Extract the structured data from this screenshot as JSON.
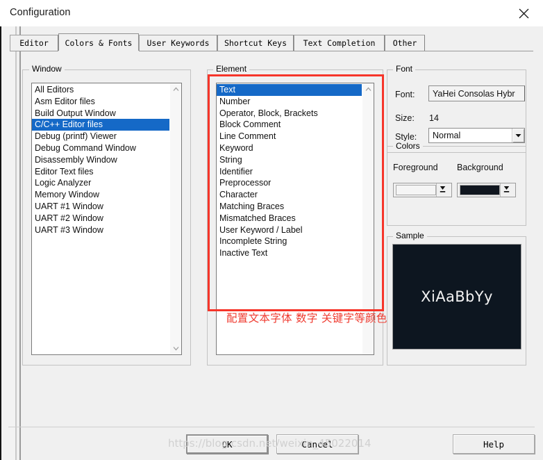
{
  "window": {
    "title": "Configuration",
    "close_icon": "close-icon"
  },
  "tabs": [
    {
      "label": "Editor",
      "selected": false
    },
    {
      "label": "Colors & Fonts",
      "selected": true
    },
    {
      "label": "User Keywords",
      "selected": false
    },
    {
      "label": "Shortcut Keys",
      "selected": false
    },
    {
      "label": "Text Completion",
      "selected": false
    },
    {
      "label": "Other",
      "selected": false
    }
  ],
  "window_group": {
    "legend": "Window",
    "items": [
      "All Editors",
      "Asm Editor files",
      "Build Output Window",
      "C/C++ Editor files",
      "Debug (printf) Viewer",
      "Debug Command Window",
      "Disassembly Window",
      "Editor Text files",
      "Logic Analyzer",
      "Memory Window",
      "UART #1 Window",
      "UART #2 Window",
      "UART #3 Window"
    ],
    "selected_index": 3,
    "scroll_up_icon": "chevron-up-icon",
    "scroll_down_icon": "chevron-down-icon"
  },
  "element_group": {
    "legend": "Element",
    "items": [
      "Text",
      "Number",
      "Operator, Block, Brackets",
      "Block Comment",
      "Line Comment",
      "Keyword",
      "String",
      "Identifier",
      "Preprocessor",
      "Character",
      "Matching Braces",
      "Mismatched Braces",
      "User Keyword / Label",
      "Incomplete String",
      "Inactive Text"
    ],
    "selected_index": 0,
    "scroll_up_icon": "chevron-up-icon"
  },
  "font_group": {
    "legend": "Font",
    "font_label": "Font:",
    "font_value": "YaHei Consolas Hybr",
    "size_label": "Size:",
    "size_value": "14",
    "style_label": "Style:",
    "style_value": "Normal",
    "style_dropdown_icon": "caret-down-icon"
  },
  "colors_group": {
    "legend": "Colors",
    "foreground_label": "Foreground",
    "background_label": "Background",
    "foreground_color": "#f5f5f5",
    "background_color": "#10161f",
    "dropdown_icon": "swatch-dropdown-icon"
  },
  "sample_group": {
    "legend": "Sample",
    "text": "XiAaBbYy",
    "text_color": "#f2f2f2",
    "bg_color": "#0d1620"
  },
  "annotation": {
    "note": "配置文本字体 数字 关键字等颜色",
    "color": "#ef3b30"
  },
  "footer": {
    "ok_label": "OK",
    "cancel_label": "Cancel",
    "help_label": "Help"
  },
  "watermark": {
    "text": "https://blog.csdn.net/weixin_45022014"
  }
}
